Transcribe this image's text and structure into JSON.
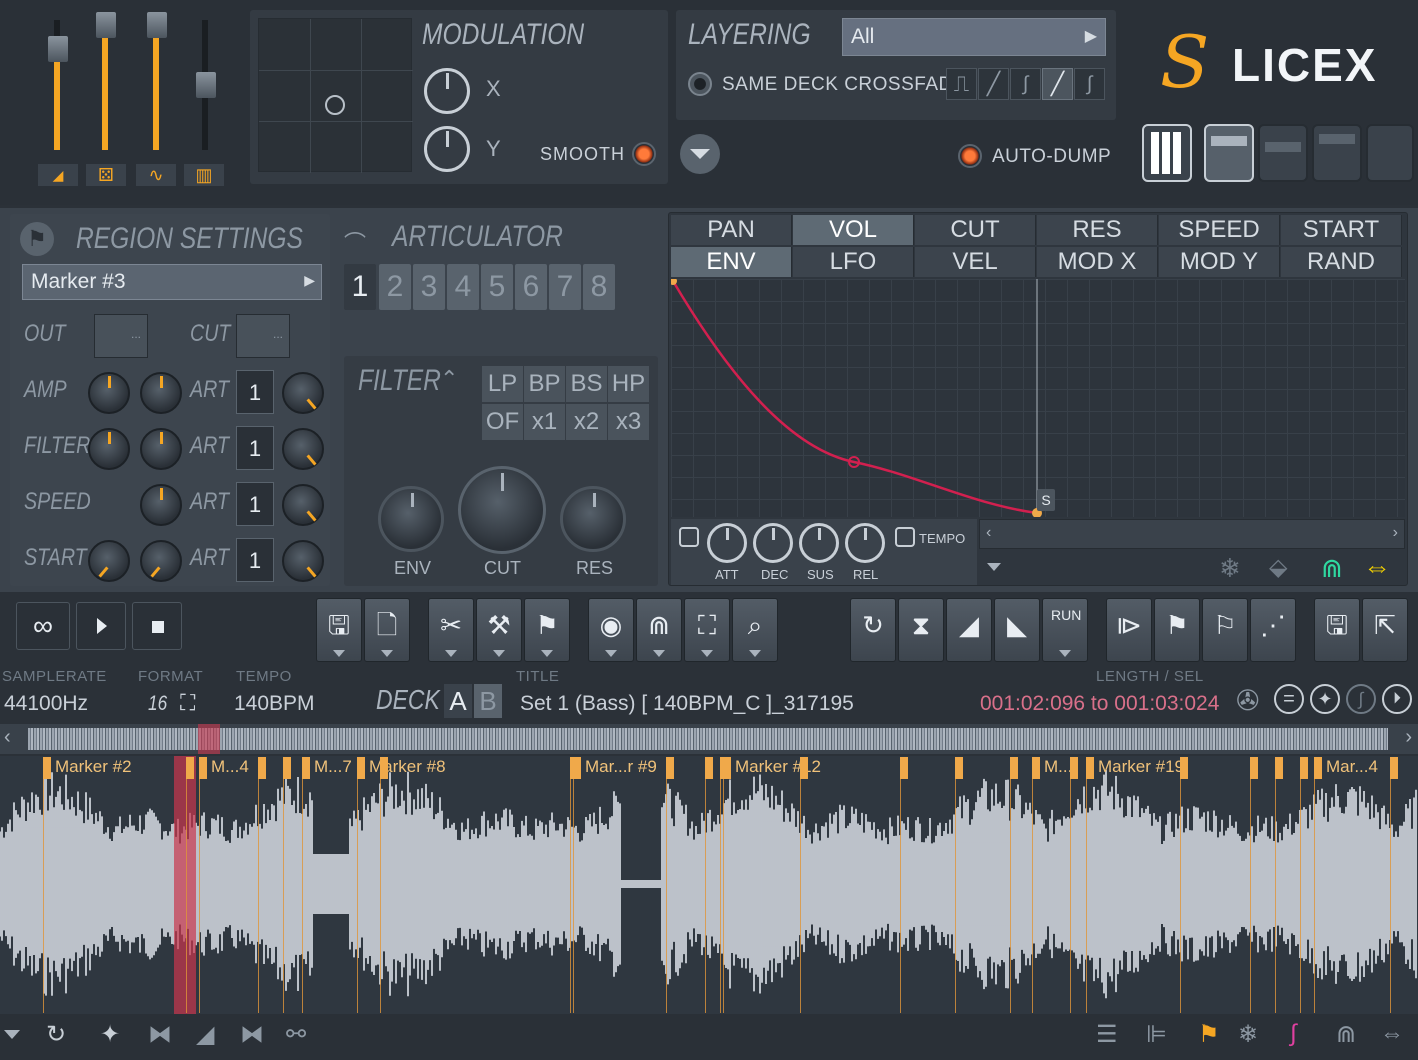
{
  "header": {
    "modulation": {
      "title": "MODULATION",
      "x_label": "X",
      "y_label": "Y",
      "smooth_label": "SMOOTH"
    },
    "layering": {
      "title": "LAYERING",
      "mode_value": "All",
      "crossfade_label": "SAME DECK CROSSFADE",
      "autodump_label": "AUTO-DUMP"
    },
    "logo": {
      "s": "S",
      "rest": "LICEX"
    }
  },
  "region": {
    "title": "REGION SETTINGS",
    "marker_value": "Marker #3",
    "out_label": "OUT",
    "cut_label": "CUT",
    "rows": [
      {
        "label": "AMP",
        "art": "ART",
        "value": "1"
      },
      {
        "label": "FILTER",
        "art": "ART",
        "value": "1"
      },
      {
        "label": "SPEED",
        "art": "ART",
        "value": "1"
      },
      {
        "label": "START",
        "art": "ART",
        "value": "1"
      }
    ],
    "dots": "..."
  },
  "articulator": {
    "title": "ARTICULATOR",
    "numbers": [
      "1",
      "2",
      "3",
      "4",
      "5",
      "6",
      "7",
      "8"
    ],
    "filter_title": "FILTER",
    "filter_types": [
      "LP",
      "BP",
      "BS",
      "HP"
    ],
    "filter_mults": [
      "OF",
      "x1",
      "x2",
      "x3"
    ],
    "knobs": [
      "ENV",
      "CUT",
      "RES"
    ]
  },
  "envelope": {
    "tabs_row1": [
      "PAN",
      "VOL",
      "CUT",
      "RES",
      "SPEED",
      "START"
    ],
    "tabs_row2": [
      "ENV",
      "LFO",
      "VEL",
      "MOD X",
      "MOD Y",
      "RAND"
    ],
    "knobs": [
      "ATT",
      "DEC",
      "SUS",
      "REL"
    ],
    "tempo_label": "TEMPO",
    "sustain_marker": "S"
  },
  "info": {
    "samplerate_label": "SAMPLERATE",
    "samplerate": "44100Hz",
    "format_label": "FORMAT",
    "format": "16",
    "tempo_label": "TEMPO",
    "tempo": "140BPM",
    "deck_label": "DECK",
    "deck_a": "A",
    "deck_b": "B",
    "title_label": "TITLE",
    "title": "Set 1 (Bass) [ 140BPM_C ]_317195",
    "length_label": "LENGTH / SEL",
    "length": "001:02:096 to 001:03:024"
  },
  "toolbar": {
    "loop": "∞",
    "run_label": "RUN"
  },
  "markers": [
    {
      "label": "Marker #2",
      "pos": 0.03
    },
    {
      "label": "M...4",
      "pos": 0.14
    },
    {
      "label": "M...7",
      "pos": 0.213
    },
    {
      "label": "Marker #8",
      "pos": 0.252
    },
    {
      "label": "Mar...r #9",
      "pos": 0.404
    },
    {
      "label": "Marker #12",
      "pos": 0.51
    },
    {
      "label": "M...",
      "pos": 0.728
    },
    {
      "label": "Marker #19",
      "pos": 0.766
    },
    {
      "label": "Mar...4",
      "pos": 0.927
    }
  ],
  "colors": {
    "accent": "#f5a623",
    "envelope": "#d2204f",
    "selection": "#c9364d"
  }
}
